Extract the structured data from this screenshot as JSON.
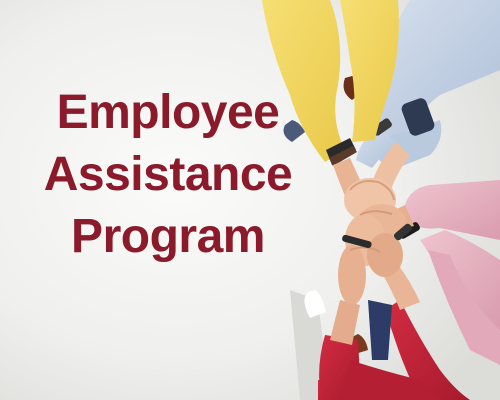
{
  "headline": {
    "line1": "Employee",
    "line2": "Assistance",
    "line3": "Program"
  },
  "colors": {
    "headline": "#8b1a2b",
    "background": "#f2f2f0",
    "yellow_sleeve": "#f2d75e",
    "blue_shirt": "#c4d2e6",
    "pink_sleeve": "#e7b3c1",
    "red_sweater": "#c22438",
    "skin": "#e9b898"
  }
}
